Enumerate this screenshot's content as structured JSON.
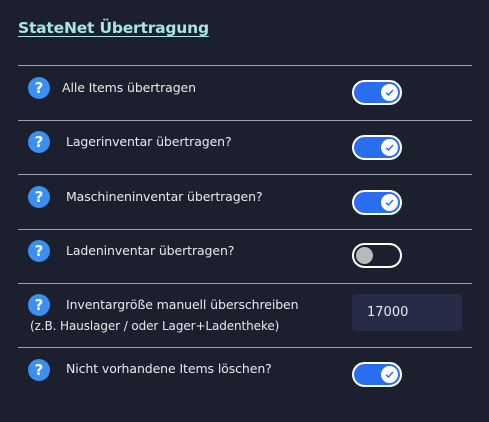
{
  "title": "StateNet Übertragung",
  "help_glyph": "?",
  "rows": [
    {
      "label": "Alle Items übertragen",
      "enabled": true
    },
    {
      "label": "Lagerinventar übertragen?",
      "enabled": true
    },
    {
      "label": "Maschineninventar übertragen?",
      "enabled": true
    },
    {
      "label": "Ladeninventar übertragen?",
      "enabled": false
    }
  ],
  "override": {
    "label_line1": "Inventargröße manuell überschreiben",
    "label_line2": "(z.B. Hauslager / oder Lager+Ladentheke)",
    "value": "17000"
  },
  "delete_missing": {
    "label": "Nicht vorhandene Items löschen?",
    "enabled": true
  },
  "colors": {
    "background": "#1c1f2e",
    "title": "#a8e6e2",
    "help_icon": "#3b8ff0",
    "toggle_on": "#2a6ef0",
    "input_bg": "#262b47"
  }
}
